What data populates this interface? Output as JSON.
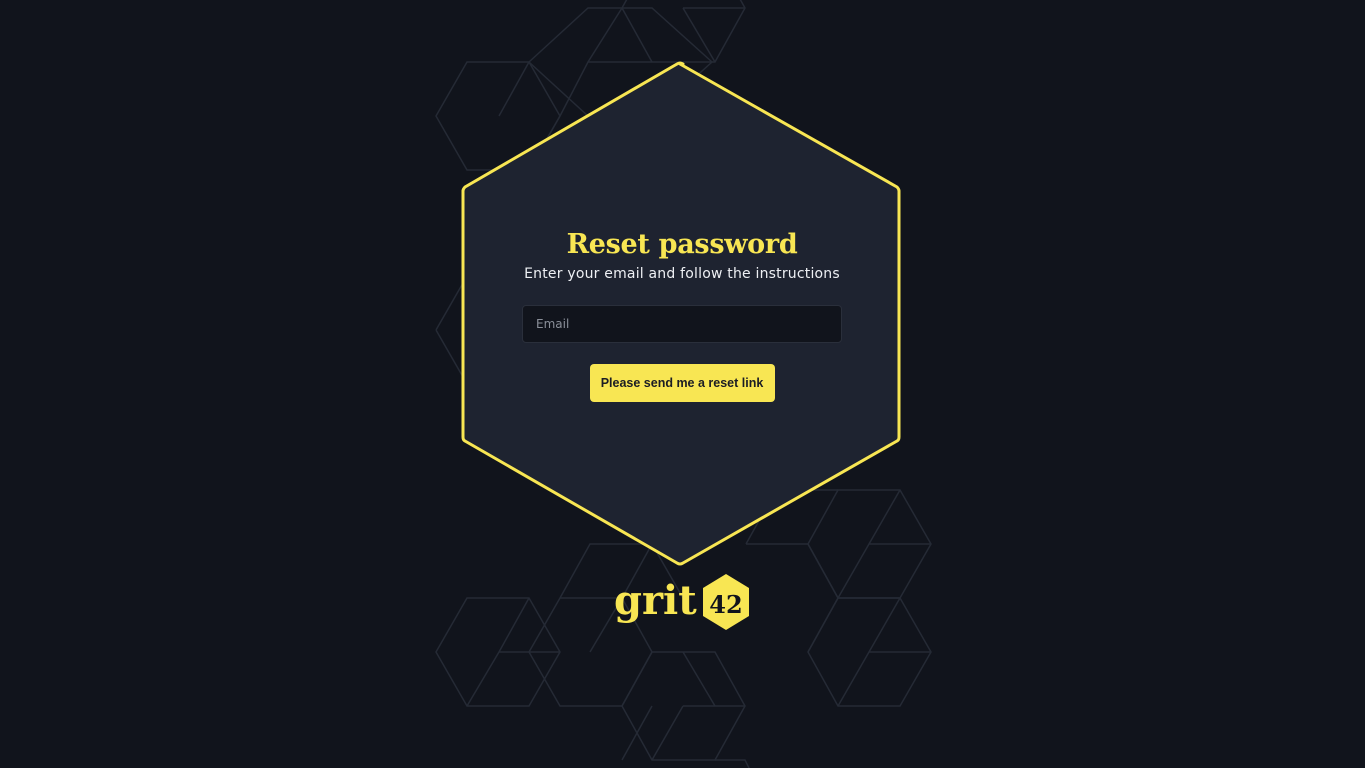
{
  "reset": {
    "title": "Reset password",
    "subtitle": "Enter your email and follow the instructions",
    "email_value": "",
    "email_placeholder": "Email",
    "submit_label": "Please send me a reset link"
  },
  "logo": {
    "word": "grit",
    "number": "42"
  },
  "colors": {
    "background": "#11141c",
    "panel": "#1e2330",
    "accent": "#f8e653",
    "input_bg": "#11141c",
    "pattern_line": "#252a35"
  },
  "icons": {
    "logo_badge": "hexagon-badge-icon",
    "background": "hexagon-pattern"
  }
}
